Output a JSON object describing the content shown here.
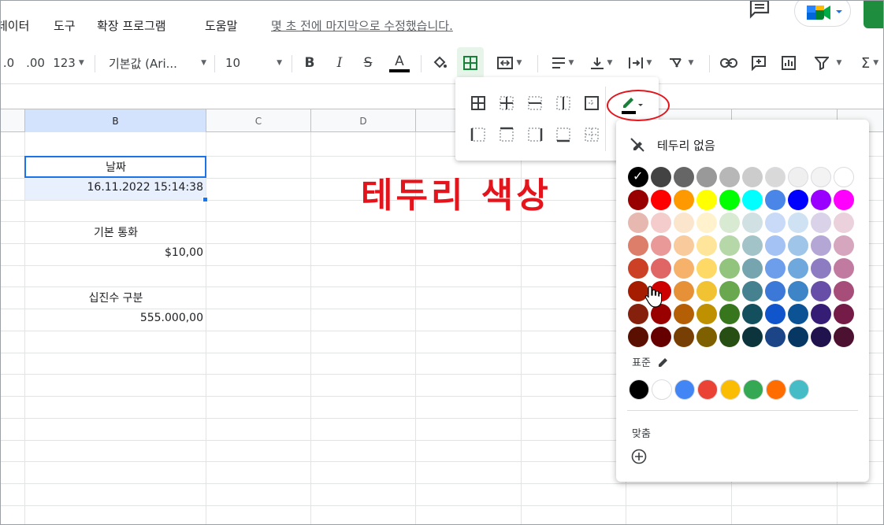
{
  "menu": {
    "items": [
      "데이터",
      "도구",
      "확장 프로그램",
      "도움말"
    ],
    "last_edit": "몇 초 전에 마지막으로 수정했습니다."
  },
  "toolbar": {
    "decrease_decimal": ".0",
    "increase_decimal": ".00",
    "number_format": "123",
    "font": "기본값 (Ari...",
    "font_size": "10",
    "bold": "B",
    "italic": "I",
    "strike": "S",
    "text_color": "A"
  },
  "columns": [
    "B",
    "C",
    "D"
  ],
  "cells": {
    "b1": "날짜",
    "b2": "16.11.2022 15:14:38",
    "b4": "기본 통화",
    "b5": "$10,00",
    "b7": "십진수 구분",
    "b8": "555.000,00"
  },
  "annotation": "테두리 색상",
  "border_color_menu": {
    "no_border": "테두리 없음",
    "standard_label": "표준",
    "custom_label": "맞춤",
    "palette_rows": [
      [
        "#000000",
        "#434343",
        "#666666",
        "#999999",
        "#b7b7b7",
        "#cccccc",
        "#d9d9d9",
        "#efefef",
        "#f3f3f3",
        "#ffffff"
      ],
      [
        "#980000",
        "#ff0000",
        "#ff9900",
        "#ffff00",
        "#00ff00",
        "#00ffff",
        "#4a86e8",
        "#0000ff",
        "#9900ff",
        "#ff00ff"
      ],
      [
        "#e6b8af",
        "#f4cccc",
        "#fce5cd",
        "#fff2cc",
        "#d9ead3",
        "#d0e0e3",
        "#c9daf8",
        "#cfe2f3",
        "#d9d2e9",
        "#ead1dc"
      ],
      [
        "#dd7e6b",
        "#ea9999",
        "#f9cb9c",
        "#ffe599",
        "#b6d7a8",
        "#a2c4c9",
        "#a4c2f4",
        "#9fc5e8",
        "#b4a7d6",
        "#d5a6bd"
      ],
      [
        "#cc4125",
        "#e06666",
        "#f6b26b",
        "#ffd966",
        "#93c47d",
        "#76a5af",
        "#6d9eeb",
        "#6fa8dc",
        "#8e7cc3",
        "#c27ba0"
      ],
      [
        "#a61c00",
        "#cc0000",
        "#e69138",
        "#f1c232",
        "#6aa84f",
        "#45818e",
        "#3c78d8",
        "#3d85c6",
        "#674ea7",
        "#a64d79"
      ],
      [
        "#85200c",
        "#990000",
        "#b45f06",
        "#bf9000",
        "#38761d",
        "#134f5c",
        "#1155cc",
        "#0b5394",
        "#351c75",
        "#741b47"
      ],
      [
        "#5b0f00",
        "#660000",
        "#783f04",
        "#7f6000",
        "#274e13",
        "#0c343d",
        "#1c4587",
        "#073763",
        "#20124d",
        "#4c1130"
      ]
    ],
    "standard_colors": [
      "#000000",
      "#ffffff",
      "#4285f4",
      "#ea4335",
      "#fbbc04",
      "#34a853",
      "#ff6d01",
      "#46bdc6"
    ]
  }
}
